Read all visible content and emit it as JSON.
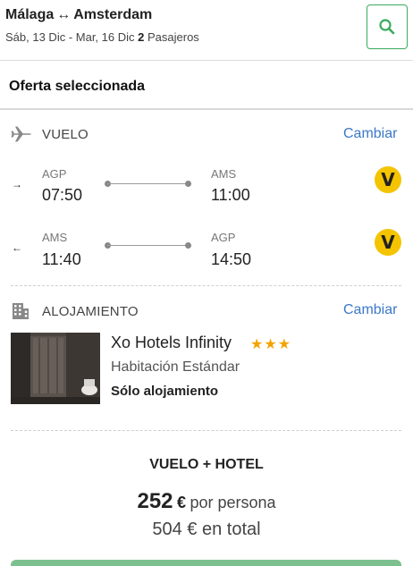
{
  "header": {
    "origin": "Málaga",
    "arrow": "↔",
    "destination": "Amsterdam",
    "dates": "Sáb, 13 Dic - Mar, 16 Dic",
    "passengers_count": "2",
    "passengers_label": "Pasajeros"
  },
  "offer": {
    "title": "Oferta seleccionada"
  },
  "flight": {
    "section_label": "VUELO",
    "change_label": "Cambiar",
    "outbound": {
      "direction_symbol": "→",
      "from_code": "AGP",
      "depart_time": "07:50",
      "to_code": "AMS",
      "arrive_time": "11:00",
      "airline_logo": "V"
    },
    "inbound": {
      "direction_symbol": "←",
      "from_code": "AMS",
      "depart_time": "11:40",
      "to_code": "AGP",
      "arrive_time": "14:50",
      "airline_logo": "V"
    }
  },
  "accommodation": {
    "section_label": "ALOJAMIENTO",
    "change_label": "Cambiar",
    "hotel_name": "Xo Hotels Infinity",
    "stars": "★★★",
    "room_type": "Habitación Estándar",
    "board": "Sólo alojamiento"
  },
  "package": {
    "title": "VUELO + HOTEL",
    "price_per_person": "252",
    "currency": "€",
    "per_person_label": "por persona",
    "price_total": "504 €",
    "total_label": "en total"
  },
  "colors": {
    "accent_green": "#3aaa5c",
    "link_blue": "#3c78c8",
    "star_orange": "#f2a400",
    "airline_yellow": "#f5c400"
  },
  "icons": {
    "search": "search-icon",
    "plane": "plane-icon",
    "hotel": "hotel-building-icon"
  }
}
